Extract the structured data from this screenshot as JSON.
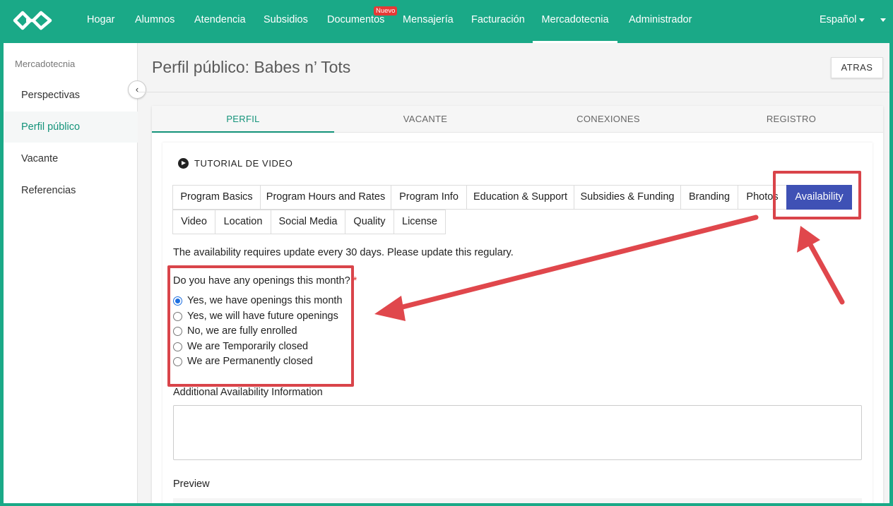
{
  "nav": {
    "items": [
      "Hogar",
      "Alumnos",
      "Atendencia",
      "Subsidios",
      "Documentos",
      "Mensajería",
      "Facturación",
      "Mercadotecnia",
      "Administrador"
    ],
    "active": "Mercadotecnia",
    "new_badge": "Nuevo",
    "language": "Español"
  },
  "sidebar": {
    "heading": "Mercadotecnia",
    "items": [
      "Perspectivas",
      "Perfil público",
      "Vacante",
      "Referencias"
    ],
    "active": "Perfil público"
  },
  "header": {
    "title": "Perfil público: Babes n’ Tots",
    "back_label": "ATRAS"
  },
  "tabs": [
    "PERFIL",
    "VACANTE",
    "CONEXIONES",
    "REGISTRO"
  ],
  "active_tab": "PERFIL",
  "video_tutorial": "TUTORIAL DE VIDEO",
  "subtabs_row1": [
    "Program Basics",
    "Program Hours and Rates",
    "Program Info",
    "Education & Support",
    "Subsidies & Funding",
    "Branding",
    "Photos",
    "Availability"
  ],
  "subtabs_row2": [
    "Video",
    "Location",
    "Social Media",
    "Quality",
    "License"
  ],
  "active_subtab": "Availability",
  "availability": {
    "note": "The availability requires update every 30 days. Please update this regulary.",
    "question": "Do you have any openings this month?",
    "required_mark": "*",
    "options": [
      "Yes, we have openings this month",
      "Yes, we will have future openings",
      "No, we are fully enrolled",
      "We are Temporarily closed",
      "We are Permanently closed"
    ],
    "selected": "Yes, we have openings this month",
    "additional_label": "Additional Availability Information",
    "additional_value": "",
    "preview_label": "Preview"
  },
  "colors": {
    "brand": "#1aa987",
    "active_green": "#14937a",
    "subtab_active": "#3f51b5",
    "annotation_red": "#e0474c"
  }
}
